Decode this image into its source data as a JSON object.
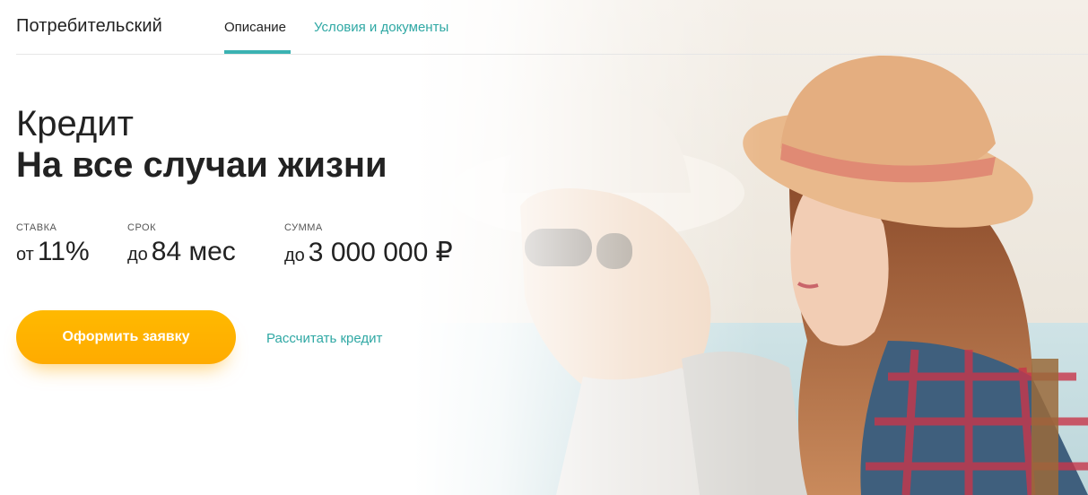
{
  "header": {
    "brand": "Потребительский",
    "tabs": [
      {
        "label": "Описание",
        "active": true
      },
      {
        "label": "Условия и документы",
        "active": false
      }
    ],
    "accent_color": "#3bb2b2",
    "link_color": "#2fa8a4"
  },
  "hero": {
    "title_light": "Кредит",
    "title_bold": "На все случаи жизни",
    "params": [
      {
        "caption": "СТАВКА",
        "prefix": "от",
        "value": "11%"
      },
      {
        "caption": "СРОК",
        "prefix": "до",
        "value": "84 мес"
      },
      {
        "caption": "СУММА",
        "prefix": "до",
        "value": "3 000 000 ₽"
      }
    ],
    "cta_label": "Оформить заявку",
    "cta_color": "#ffb000",
    "calc_link": "Рассчитать кредит"
  },
  "background": {
    "description_icon": "couple-photo"
  }
}
